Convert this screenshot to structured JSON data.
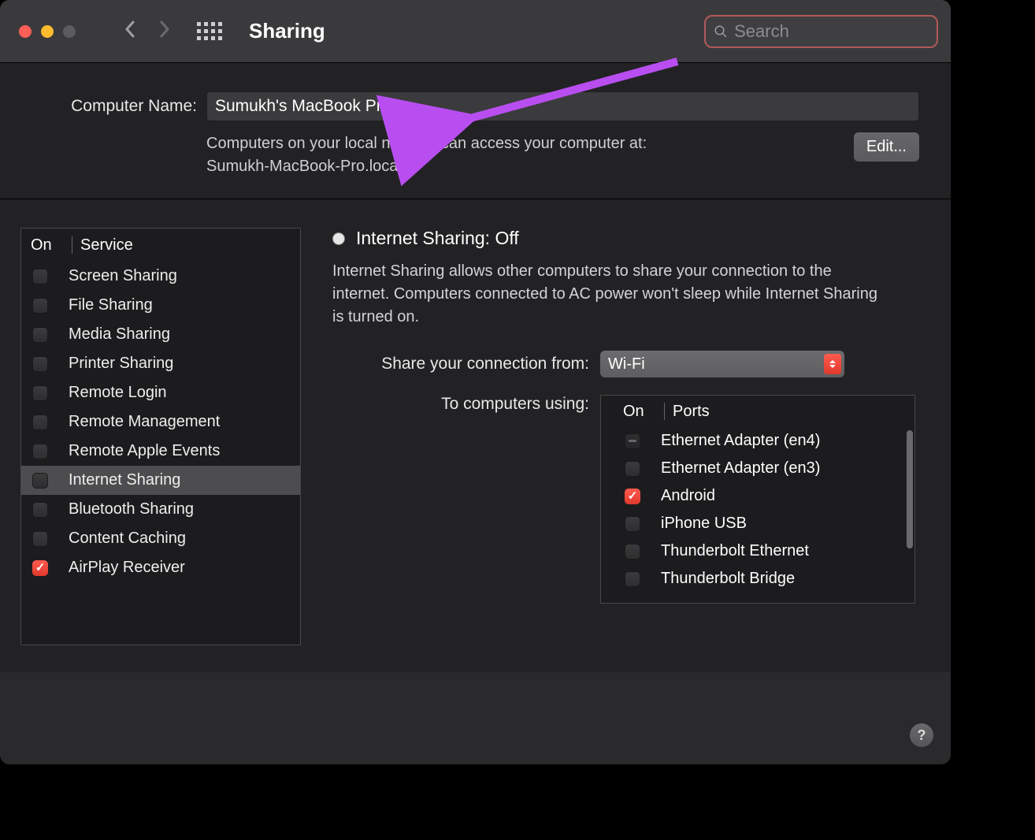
{
  "titlebar": {
    "title": "Sharing",
    "search_placeholder": "Search"
  },
  "computer_name": {
    "label": "Computer Name:",
    "value": "Sumukh's MacBook Pro",
    "hint_line1": "Computers on your local network can access your computer at:",
    "hint_line2": "Sumukh-MacBook-Pro.local",
    "edit_label": "Edit..."
  },
  "services": {
    "header_on": "On",
    "header_service": "Service",
    "items": [
      {
        "label": "Screen Sharing",
        "checked": false,
        "selected": false
      },
      {
        "label": "File Sharing",
        "checked": false,
        "selected": false
      },
      {
        "label": "Media Sharing",
        "checked": false,
        "selected": false
      },
      {
        "label": "Printer Sharing",
        "checked": false,
        "selected": false
      },
      {
        "label": "Remote Login",
        "checked": false,
        "selected": false
      },
      {
        "label": "Remote Management",
        "checked": false,
        "selected": false
      },
      {
        "label": "Remote Apple Events",
        "checked": false,
        "selected": false
      },
      {
        "label": "Internet Sharing",
        "checked": false,
        "selected": true
      },
      {
        "label": "Bluetooth Sharing",
        "checked": false,
        "selected": false
      },
      {
        "label": "Content Caching",
        "checked": false,
        "selected": false
      },
      {
        "label": "AirPlay Receiver",
        "checked": true,
        "selected": false
      }
    ]
  },
  "detail": {
    "title": "Internet Sharing: Off",
    "description": "Internet Sharing allows other computers to share your connection to the internet. Computers connected to AC power won't sleep while Internet Sharing is turned on.",
    "connection_label": "Share your connection from:",
    "connection_value": "Wi-Fi",
    "ports_label": "To computers using:",
    "ports_header_on": "On",
    "ports_header_ports": "Ports",
    "ports": [
      {
        "label": "Ethernet Adapter (en4)",
        "checked": "partial"
      },
      {
        "label": "Ethernet Adapter (en3)",
        "checked": false
      },
      {
        "label": "Android",
        "checked": true
      },
      {
        "label": "iPhone USB",
        "checked": false
      },
      {
        "label": "Thunderbolt Ethernet",
        "checked": false
      },
      {
        "label": "Thunderbolt Bridge",
        "checked": false
      }
    ]
  },
  "help_label": "?"
}
